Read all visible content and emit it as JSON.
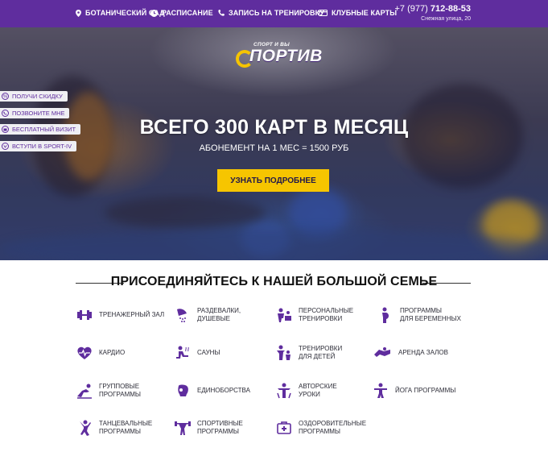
{
  "colors": {
    "brand": "#5f2d9e",
    "accent": "#f6c500",
    "text_dark": "#111111"
  },
  "topbar": {
    "location": {
      "icon": "map-pin-icon",
      "label": "Ботанический сад"
    },
    "schedule": {
      "icon": "clock-icon",
      "label": "Расписание"
    },
    "booking": {
      "icon": "phone-icon",
      "label": "Запись на тренировку"
    },
    "cards": {
      "icon": "card-icon",
      "label": "Клубные карты"
    },
    "phone_prefix": "+7 (977)",
    "phone_number": "712-88-53",
    "address": "Снежная улица, 20"
  },
  "logo": {
    "tagline": "СПОРТ И ВЫ",
    "name": "ПОРТИВ"
  },
  "side_tabs": [
    {
      "icon": "discount-icon",
      "label": "Получи скидку"
    },
    {
      "icon": "phone-call-icon",
      "label": "Позвоните мне"
    },
    {
      "icon": "gift-icon",
      "label": "Бесплатный визит"
    },
    {
      "icon": "vk-icon",
      "label": "Вступи в Sport-IV"
    }
  ],
  "hero": {
    "title": "ВСЕГО 300 КАРТ В МЕСЯЦ",
    "subtitle": "АБОНЕМЕНТ НА 1 МЕС = 1500 РУБ",
    "button": "УЗНАТЬ ПОДРОБНЕЕ"
  },
  "section": {
    "title": "ПРИСОЕДИНЯЙТЕСЬ К НАШЕЙ БОЛЬШОЙ СЕМЬЕ",
    "features": [
      {
        "icon": "dumbbell-icon",
        "label": "Тренажерный зал"
      },
      {
        "icon": "shower-icon",
        "label": "Раздевалки,\nдушевые"
      },
      {
        "icon": "trainer-icon",
        "label": "Персональные\nтренировки"
      },
      {
        "icon": "pregnant-icon",
        "label": "Программы\nдля беременных"
      },
      {
        "icon": "heart-pulse-icon",
        "label": "Кардио"
      },
      {
        "icon": "sauna-icon",
        "label": "Сауны"
      },
      {
        "icon": "kids-icon",
        "label": "Тренировки\nдля детей"
      },
      {
        "icon": "rental-icon",
        "label": "Аренда залов"
      },
      {
        "icon": "group-icon",
        "label": "Групповые\nпрограммы"
      },
      {
        "icon": "boxing-glove-icon",
        "label": "Единоборства"
      },
      {
        "icon": "author-icon",
        "label": "Авторские\nуроки"
      },
      {
        "icon": "yoga-icon",
        "label": "Йога программы"
      },
      {
        "icon": "dance-icon",
        "label": "Танцевальные\nпрограммы"
      },
      {
        "icon": "weightlifting-icon",
        "label": "Спортивные\nпрограммы"
      },
      {
        "icon": "first-aid-icon",
        "label": "Оздоровительные\nпрограммы"
      }
    ]
  }
}
